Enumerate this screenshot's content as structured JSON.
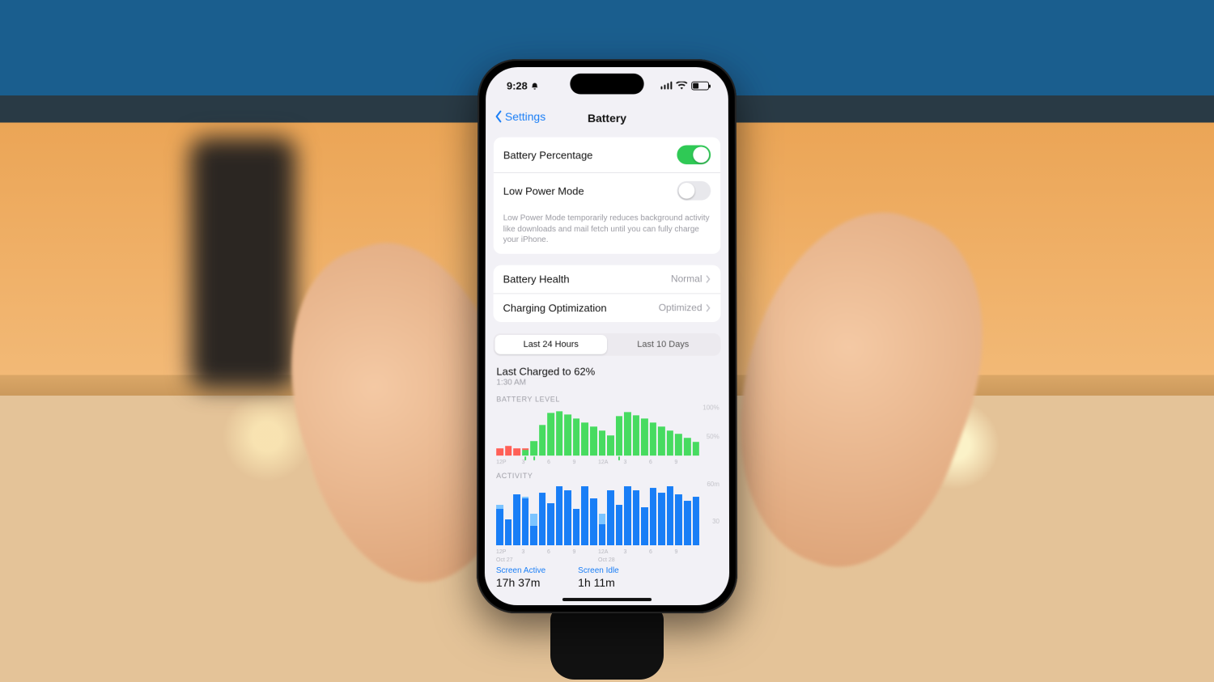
{
  "status": {
    "time": "9:28",
    "dnd": true
  },
  "nav": {
    "back": "Settings",
    "title": "Battery"
  },
  "toggles": {
    "percentage": {
      "label": "Battery Percentage",
      "on": true
    },
    "lowpower": {
      "label": "Low Power Mode",
      "on": false,
      "footnote": "Low Power Mode temporarily reduces background activity like downloads and mail fetch until you can fully charge your iPhone."
    }
  },
  "links": {
    "health": {
      "label": "Battery Health",
      "value": "Normal"
    },
    "charging": {
      "label": "Charging Optimization",
      "value": "Optimized"
    }
  },
  "segmented": {
    "a": "Last 24 Hours",
    "b": "Last 10 Days",
    "active": "a"
  },
  "charged": {
    "headline": "Last Charged to 62%",
    "time": "1:30 AM"
  },
  "labels": {
    "level": "BATTERY LEVEL",
    "activity": "ACTIVITY",
    "ymax": "100%",
    "ymid": "50%",
    "min": "60m",
    "half": "30"
  },
  "metrics": {
    "active": {
      "label": "Screen Active",
      "value": "17h 37m"
    },
    "idle": {
      "label": "Screen Idle",
      "value": "1h 11m"
    }
  },
  "chart_data": [
    {
      "type": "bar",
      "title": "BATTERY LEVEL",
      "ylabel": "%",
      "ylim": [
        0,
        100
      ],
      "hours": [
        "12P",
        "3",
        "6",
        "9",
        "12A",
        "3",
        "6",
        "9"
      ],
      "series": [
        {
          "name": "normal",
          "color": "#4cd964",
          "values": [
            0,
            0,
            0,
            10,
            28,
            60,
            85,
            88,
            82,
            74,
            66,
            58,
            50,
            40,
            78,
            86,
            80,
            74,
            66,
            58,
            50,
            42,
            34,
            26
          ]
        },
        {
          "name": "low-power",
          "color": "#ff6259",
          "values": [
            14,
            18,
            14,
            14,
            14,
            0,
            0,
            0,
            0,
            0,
            0,
            0,
            22,
            20,
            0,
            0,
            0,
            0,
            0,
            0,
            0,
            0,
            18,
            18
          ]
        }
      ],
      "charge_events_at_index": [
        3,
        4,
        14
      ]
    },
    {
      "type": "bar",
      "title": "ACTIVITY",
      "ylabel": "minutes",
      "ylim": [
        0,
        60
      ],
      "hours": [
        "12P",
        "3",
        "6",
        "9",
        "12A",
        "3",
        "6",
        "9"
      ],
      "date_markers": [
        "Oct 27",
        "Oct 28"
      ],
      "series": [
        {
          "name": "Screen Active",
          "color": "#1d7df0",
          "values": [
            34,
            24,
            48,
            44,
            18,
            50,
            40,
            56,
            52,
            34,
            56,
            44,
            20,
            52,
            38,
            56,
            52,
            36,
            54,
            50,
            56,
            48,
            42,
            46
          ]
        },
        {
          "name": "Screen Idle",
          "color": "#7fc3ff",
          "values": [
            4,
            0,
            0,
            2,
            12,
            0,
            0,
            0,
            0,
            0,
            0,
            0,
            10,
            0,
            0,
            0,
            0,
            0,
            0,
            0,
            0,
            0,
            0,
            0
          ]
        }
      ]
    }
  ]
}
